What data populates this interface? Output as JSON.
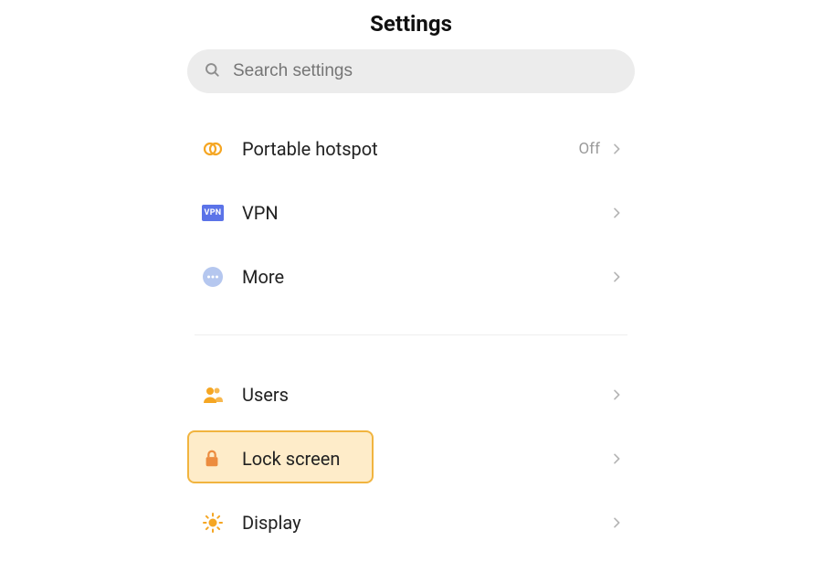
{
  "header": {
    "title": "Settings"
  },
  "search": {
    "placeholder": "Search settings"
  },
  "rows": [
    {
      "id": "hotspot",
      "label": "Portable hotspot",
      "value": "Off"
    },
    {
      "id": "vpn",
      "label": "VPN"
    },
    {
      "id": "more",
      "label": "More"
    },
    {
      "id": "users",
      "label": "Users"
    },
    {
      "id": "lock",
      "label": "Lock screen",
      "highlighted": true
    },
    {
      "id": "display",
      "label": "Display"
    }
  ],
  "vpn_badge": "VPN",
  "colors": {
    "accent_orange": "#f5a623",
    "highlight_bg": "#feecc9",
    "highlight_border": "#f1b43f",
    "vpn_blue": "#5b73e8",
    "more_blue": "#b5c7ef",
    "chevron": "#b5b5b5",
    "search_bg": "#ececec"
  }
}
